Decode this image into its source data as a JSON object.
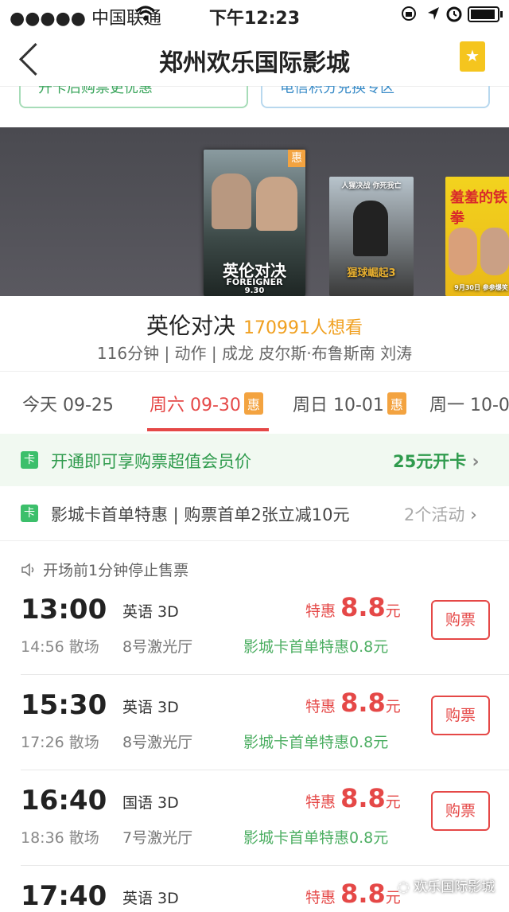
{
  "status_bar": {
    "carrier": "●●●●● 中国联通",
    "time": "下午12:23",
    "icons": [
      "wifi-icon",
      "lock-rotation-icon",
      "location-icon",
      "alarm-icon",
      "battery-icon"
    ]
  },
  "nav": {
    "title": "郑州欢乐国际影城"
  },
  "promos": {
    "left": "开卡后购票更优惠",
    "right": "电信积分兑换专区"
  },
  "posters": [
    {
      "title": "英伦对决",
      "sub": "FOREIGNER",
      "date": "9.30",
      "badge": "惠"
    },
    {
      "title": "猩球崛起3",
      "sub": "人猩决战 你死我亡"
    },
    {
      "title": "羞羞的铁拳",
      "sub": "9月30日 参参爆笑"
    }
  ],
  "movie": {
    "title": "英伦对决",
    "want": "170991人想看",
    "info": "116分钟 | 动作 | 成龙 皮尔斯·布鲁斯南 刘涛"
  },
  "tabs": [
    {
      "label": "今天 09-25",
      "badge": ""
    },
    {
      "label": "周六 09-30",
      "badge": "惠"
    },
    {
      "label": "周日 10-01",
      "badge": "惠"
    },
    {
      "label": "周一 10-0",
      "badge": ""
    }
  ],
  "card": {
    "icon": "卡",
    "text": "开通即可享购票超值会员价",
    "action": "25元开卡"
  },
  "activity": {
    "icon": "卡",
    "text": "影城卡首单特惠 | 购票首单2张立减10元",
    "count": "2个活动"
  },
  "notice": "开场前1分钟停止售票",
  "sessions": [
    {
      "start": "13:00",
      "end": "14:56 散场",
      "lang": "英语 3D",
      "hall": "8号激光厅",
      "price_label": "特惠",
      "price": "8.8",
      "unit": "元",
      "discount": "影城卡首单特惠0.8元",
      "button": "购票"
    },
    {
      "start": "15:30",
      "end": "17:26 散场",
      "lang": "英语 3D",
      "hall": "8号激光厅",
      "price_label": "特惠",
      "price": "8.8",
      "unit": "元",
      "discount": "影城卡首单特惠0.8元",
      "button": "购票"
    },
    {
      "start": "16:40",
      "end": "18:36 散场",
      "lang": "国语 3D",
      "hall": "7号激光厅",
      "price_label": "特惠",
      "price": "8.8",
      "unit": "元",
      "discount": "影城卡首单特惠0.8元",
      "button": "购票"
    },
    {
      "start": "17:40",
      "end": "",
      "lang": "英语 3D",
      "hall": "",
      "price_label": "特惠",
      "price": "8.8",
      "unit": "元",
      "discount": "",
      "button": ""
    }
  ],
  "watermark": "欢乐国际影城"
}
